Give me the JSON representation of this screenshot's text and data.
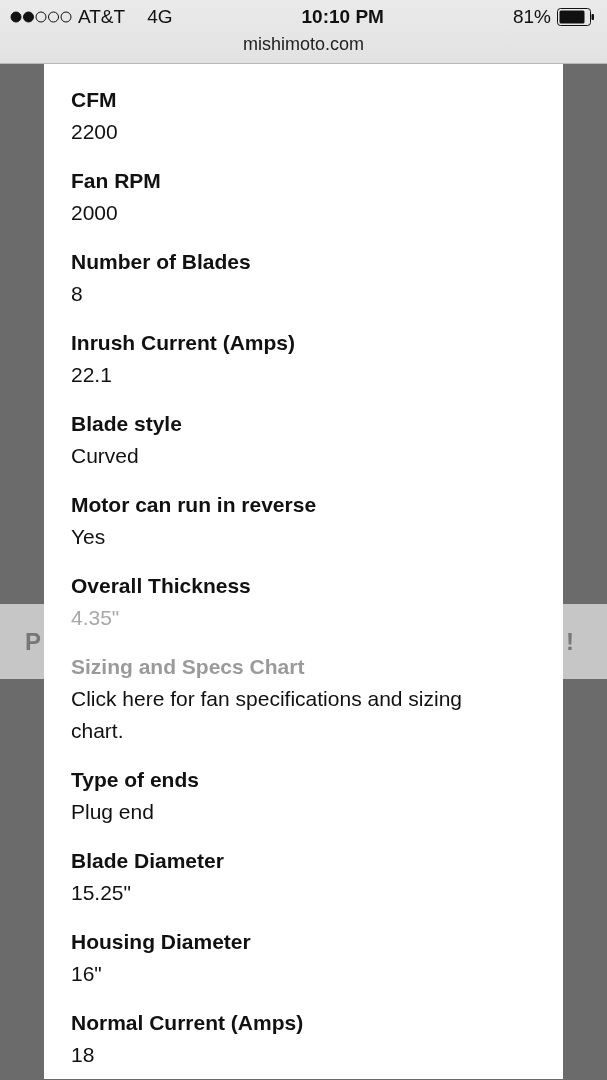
{
  "status_bar": {
    "carrier": "AT&T",
    "network": "4G",
    "time": "10:10 PM",
    "battery": "81%"
  },
  "address_bar": {
    "url": "mishimoto.com"
  },
  "background_banner": {
    "left_text": "P",
    "right_text": "!"
  },
  "specs": [
    {
      "label": "CFM",
      "value": "2200",
      "label_muted": false,
      "value_muted": false
    },
    {
      "label": "Fan RPM",
      "value": "2000",
      "label_muted": false,
      "value_muted": false
    },
    {
      "label": "Number of Blades",
      "value": "8",
      "label_muted": false,
      "value_muted": false
    },
    {
      "label": "Inrush Current (Amps)",
      "value": "22.1",
      "label_muted": false,
      "value_muted": false
    },
    {
      "label": "Blade style",
      "value": "Curved",
      "label_muted": false,
      "value_muted": false
    },
    {
      "label": "Motor can run in reverse",
      "value": "Yes",
      "label_muted": false,
      "value_muted": false
    },
    {
      "label": "Overall Thickness",
      "value": "4.35\"",
      "label_muted": false,
      "value_muted": true
    },
    {
      "label": "Sizing and Specs Chart",
      "value": "Click here for fan specifications and sizing chart.",
      "label_muted": true,
      "value_muted": false
    },
    {
      "label": "Type of ends",
      "value": "Plug end",
      "label_muted": false,
      "value_muted": false
    },
    {
      "label": "Blade Diameter",
      "value": "15.25\"",
      "label_muted": false,
      "value_muted": false
    },
    {
      "label": "Housing Diameter",
      "value": "16\"",
      "label_muted": false,
      "value_muted": false
    },
    {
      "label": "Normal Current (Amps)",
      "value": "18",
      "label_muted": false,
      "value_muted": false
    }
  ]
}
